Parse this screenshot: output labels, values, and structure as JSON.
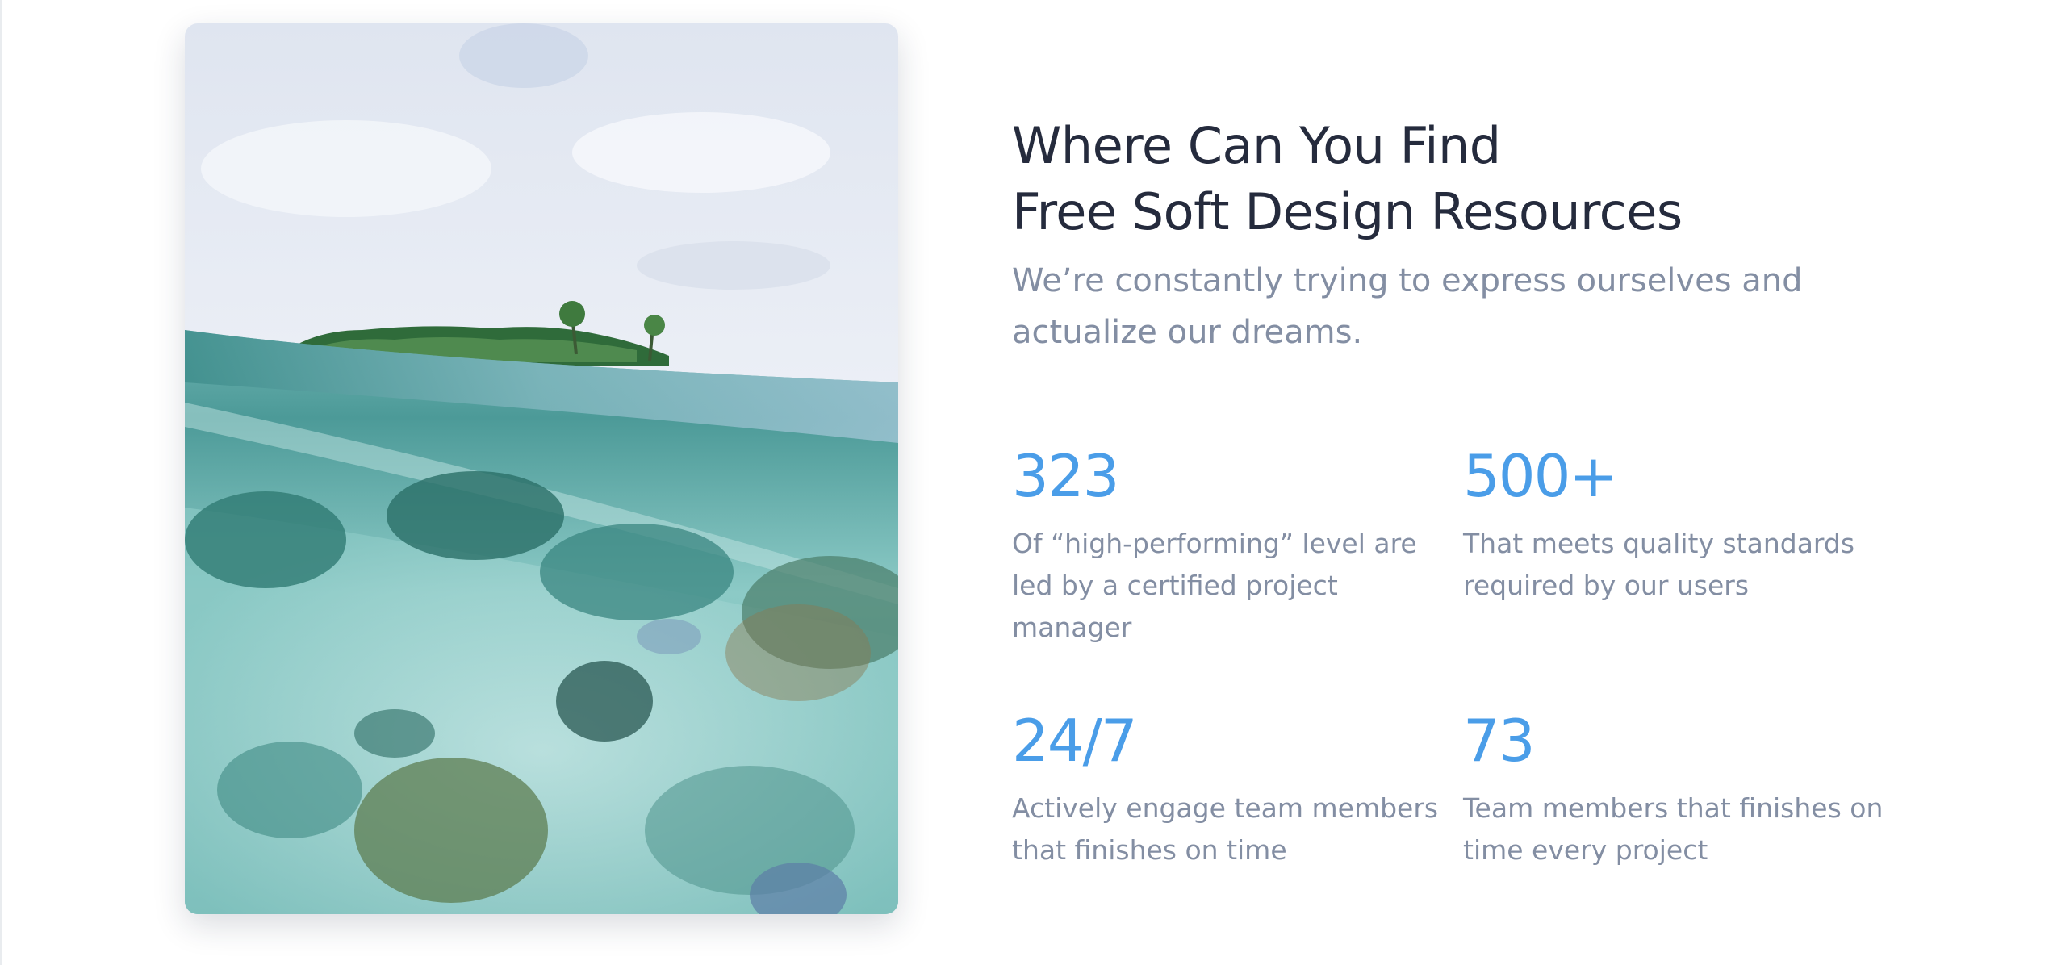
{
  "section": {
    "title_line_1": "Where Can You Find",
    "title_line_2": "Free Soft Design Resources",
    "subtitle": "We’re constantly trying to express ourselves and actualize our dreams."
  },
  "stats": [
    {
      "value": "323",
      "description": "Of “high-performing” level are led by a certified project manager"
    },
    {
      "value": "500+",
      "description": "That meets quality standards required by our users"
    },
    {
      "value": "24/7",
      "description": "Actively engage team members that finishes on time"
    },
    {
      "value": "73",
      "description": "Team members that finishes on time every project"
    }
  ],
  "colors": {
    "heading": "#252b3d",
    "body_text": "#838ea3",
    "accent": "#4a9de8"
  }
}
